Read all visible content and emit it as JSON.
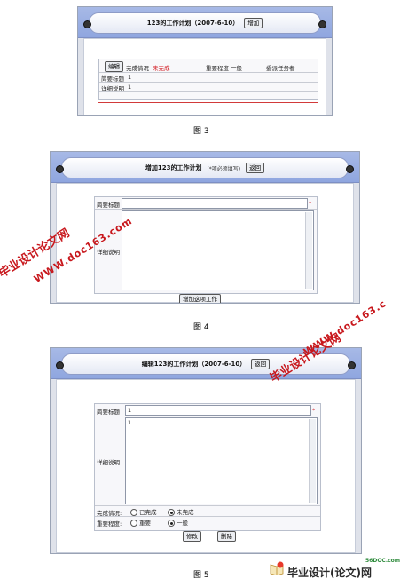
{
  "fig3": {
    "title": "123的工作计划（2007-6-10）",
    "add_button": "增加",
    "edit_button": "编辑",
    "status_label": "完成情况",
    "status_value": "未完成",
    "importance_label": "重要程度",
    "importance_value": "一般",
    "assigner_label": "委派任务者",
    "summary_label": "简要标题",
    "summary_value": "1",
    "detail_label": "详细说明",
    "detail_value": "1",
    "caption": "图 3"
  },
  "fig4": {
    "title": "增加123的工作计划",
    "note": "(*项必须填写)",
    "back_button": "返回",
    "summary_label": "简要标题",
    "detail_label": "详细说明",
    "required_mark": "*",
    "submit_button": "增加这项工作",
    "caption": "图 4"
  },
  "fig5": {
    "title": "编辑123的工作计划（2007-6-10）",
    "back_button": "返回",
    "summary_label": "简要标题",
    "summary_value": "1",
    "detail_label": "详细说明",
    "detail_value": "1",
    "required_mark": "*",
    "status_label": "完成情况:",
    "status_done": "已完成",
    "status_undone": "未完成",
    "importance_label": "重要程度:",
    "importance_high": "重要",
    "importance_normal": "一般",
    "modify_button": "修改",
    "delete_button": "删除",
    "caption": "图 5"
  },
  "watermarks": {
    "site_name": "毕业设计论文网",
    "site_url": "WWW.doc163.com",
    "site_url_c": "WWW.doc163.c"
  },
  "footer_logo": {
    "domain": "56DOC.com",
    "name": "毕业设计(论文)网"
  }
}
